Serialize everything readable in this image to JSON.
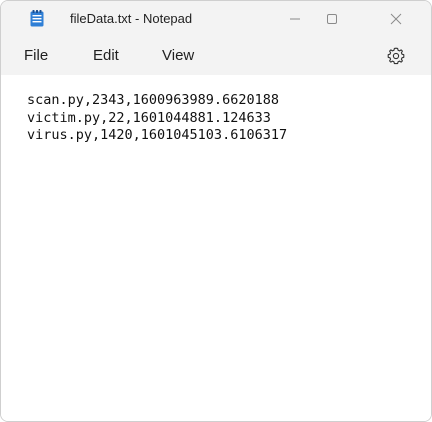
{
  "window": {
    "title": "fileData.txt - Notepad",
    "app_icon": "notepad-icon",
    "controls": {
      "minimize_icon": "minimize-icon",
      "maximize_icon": "maximize-icon",
      "close_icon": "close-icon"
    }
  },
  "menubar": {
    "items": [
      {
        "label": "File"
      },
      {
        "label": "Edit"
      },
      {
        "label": "View"
      }
    ],
    "settings_icon": "settings-gear-icon"
  },
  "editor": {
    "lines": [
      "scan.py,2343,1600963989.6620188",
      "victim.py,22,1601044881.124633",
      "virus.py,1420,1601045103.6106317"
    ]
  },
  "colors": {
    "titlebar_bg": "#f3f3f3",
    "editor_bg": "#ffffff",
    "notepad_icon_blue": "#2f7fd6"
  }
}
